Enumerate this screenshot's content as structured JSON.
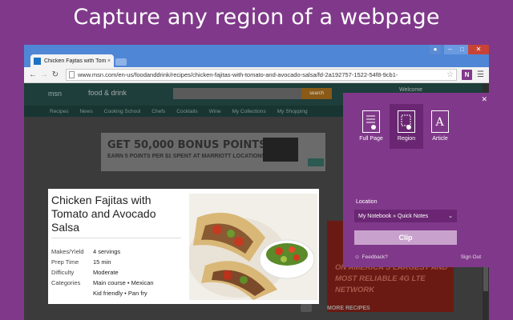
{
  "headline": "Capture any region of a webpage",
  "browser": {
    "tab_title": "Chicken Fajitas with Toma",
    "tab_close": "×",
    "url": "www.msn.com/en-us/foodanddrink/recipes/chicken-fajitas-with-tomato-and-avocado-salsa/fd-2a192757-1522-54f8-9cb1-",
    "extension_label": "N"
  },
  "msn": {
    "logo": "msn",
    "section": "food & drink",
    "search_button": "search",
    "welcome": "Welcome",
    "nav": [
      "Recipes",
      "News",
      "Cooking School",
      "Chefs",
      "Cocktails",
      "Wine",
      "My Collections",
      "My Shopping"
    ],
    "ad_headline": "GET 50,000 BONUS POINTS",
    "ad_sub": "EARN 5 POINTS PER $1 SPENT AT MARRIOTT LOCATIONS",
    "right_ad": "ON AMERICA'S LARGEST AND MOST RELIABLE 4G LTE NETWORK",
    "more_recipes": "MORE RECIPES"
  },
  "recipe": {
    "title": "Chicken Fajitas with Tomato and Avocado Salsa",
    "facts": [
      {
        "label": "Makes/Yield",
        "value": "4 servings"
      },
      {
        "label": "Prep Time",
        "value": "15 min"
      },
      {
        "label": "Difficulty",
        "value": "Moderate"
      },
      {
        "label": "Categories",
        "value": "Main course  •  Mexican"
      },
      {
        "label": "",
        "value": "Kid friendly  •  Pan fry"
      }
    ]
  },
  "clipper": {
    "modes": [
      {
        "label": "Full Page",
        "selected": false
      },
      {
        "label": "Region",
        "selected": true
      },
      {
        "label": "Article",
        "selected": false
      }
    ],
    "location_label": "Location",
    "location_value": "My Notebook » Quick Notes",
    "clip_button": "Clip",
    "feedback": "Feedback?",
    "sign_out": "Sign Out",
    "accent": "#80398a"
  }
}
